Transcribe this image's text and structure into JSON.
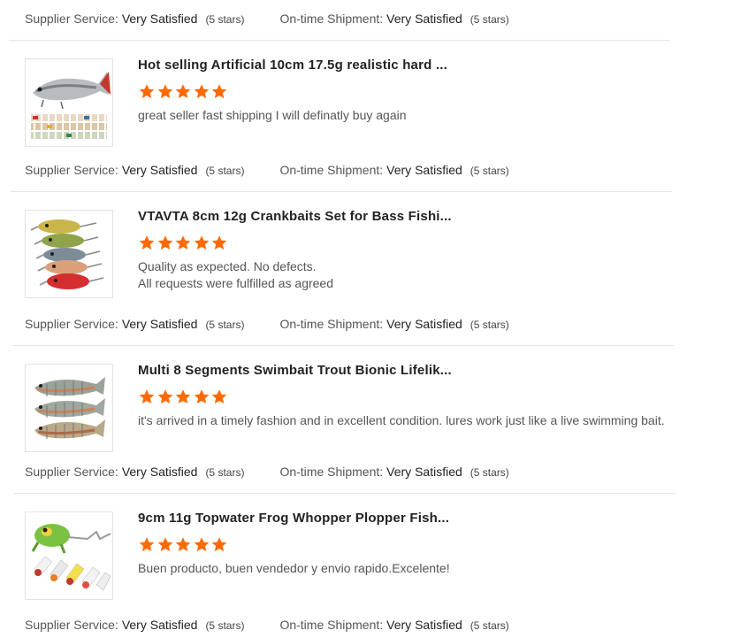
{
  "rating_labels": {
    "supplier_service": "Supplier Service:",
    "ontime_shipment": "On-time Shipment:",
    "very_satisfied": "Very Satisfied",
    "five_stars": "(5 stars)"
  },
  "colors": {
    "star": "#ff6a00"
  },
  "star_rating": 5,
  "reviews": [
    {
      "title": "Hot selling Artificial 10cm 17.5g realistic hard ...",
      "text_lines": [
        "great seller fast shipping I will definatly buy again"
      ],
      "thumbnail_icon": "swimbait-lure-set-image"
    },
    {
      "title": "VTAVTA 8cm 12g Crankbaits Set for Bass Fishi...",
      "text_lines": [
        "Quality as expected. No defects.",
        "All requests were fulfilled as agreed"
      ],
      "thumbnail_icon": "crankbait-set-image"
    },
    {
      "title": "Multi 8 Segments Swimbait Trout Bionic Lifelik...",
      "text_lines": [
        "it's arrived in a timely fashion and in excellent condition. lures work just like a live swimming bait."
      ],
      "thumbnail_icon": "segmented-trout-lure-image"
    },
    {
      "title": "9cm 11g Topwater Frog Whopper Plopper Fish...",
      "text_lines": [
        "Buen producto, buen vendedor y envio rapido.Excelente!"
      ],
      "thumbnail_icon": "frog-plopper-lure-image"
    }
  ]
}
